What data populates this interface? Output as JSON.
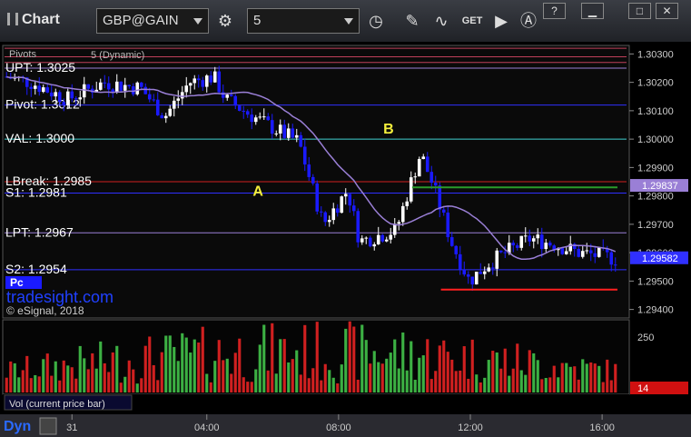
{
  "app": {
    "title": "Chart"
  },
  "toolbar": {
    "symbol": "GBP@GAIN",
    "interval": "5",
    "get_label": "GET"
  },
  "overlay": {
    "study_label": "Pivots",
    "ma_label": "5 (Dynamic)",
    "watermark": "tradesight.com",
    "copyright": "© eSignal, 2018",
    "pc_badge": "Pc",
    "vol_label": "Vol (current price bar)",
    "dyn_label": "Dyn"
  },
  "colors": {
    "up": "#ffffff",
    "down": "#1a1aff",
    "ma": "#9a7fd6",
    "vol_up": "#3cb043",
    "vol_down": "#d02020"
  },
  "chart_data": {
    "type": "candlestick",
    "ylim": [
      1.2937,
      1.3033
    ],
    "y_ticks": [
      "1.30300",
      "1.30200",
      "1.30100",
      "1.30000",
      "1.29900",
      "1.29800",
      "1.29700",
      "1.29600",
      "1.29500",
      "1.29400"
    ],
    "x_ticks": [
      "31",
      "04:00",
      "08:00",
      "12:00",
      "16:00"
    ],
    "levels": [
      {
        "label": "UPT: 1.3025",
        "value": 1.3025,
        "color": "#9a7fd6"
      },
      {
        "label": "Pivot: 1.3012",
        "value": 1.3012,
        "color": "#3030ff"
      },
      {
        "label": "VAL: 1.3000",
        "value": 1.3,
        "color": "#40d0d0"
      },
      {
        "label": "LBreak: 1.2985",
        "value": 1.2985,
        "color": "#d02020"
      },
      {
        "label": "S1: 1.2981",
        "value": 1.2981,
        "color": "#3030ff"
      },
      {
        "label": "LPT: 1.2967",
        "value": 1.2967,
        "color": "#9a7fd6"
      },
      {
        "label": "S2: 1.2954",
        "value": 1.2954,
        "color": "#3030ff"
      }
    ],
    "top_lines": [
      1.3032,
      1.3029,
      1.3027
    ],
    "price_badges": [
      {
        "label": "1.29837",
        "value": 1.29837,
        "color": "#9a7fd6"
      },
      {
        "label": "1.29582",
        "value": 1.29582,
        "color": "#3030ff"
      }
    ],
    "annotations": [
      {
        "text": "A",
        "x": 0.405,
        "value": 1.298
      },
      {
        "text": "B",
        "x": 0.618,
        "value": 1.3002
      }
    ],
    "marker_lines": [
      {
        "value": 1.2983,
        "x0": 0.665,
        "x1": 1.0,
        "color": "#2a9a2a"
      },
      {
        "value": 1.2947,
        "x0": 0.712,
        "x1": 1.0,
        "color": "#ff2020"
      }
    ],
    "anchors": [
      [
        0,
        1.3022
      ],
      [
        0.04,
        1.302
      ],
      [
        0.1,
        1.3014
      ],
      [
        0.16,
        1.302
      ],
      [
        0.22,
        1.3018
      ],
      [
        0.26,
        1.3008
      ],
      [
        0.3,
        1.302
      ],
      [
        0.34,
        1.3022
      ],
      [
        0.36,
        1.3014
      ],
      [
        0.42,
        1.3006
      ],
      [
        0.48,
        1.2999
      ],
      [
        0.52,
        1.297
      ],
      [
        0.56,
        1.2982
      ],
      [
        0.58,
        1.2964
      ],
      [
        0.64,
        1.2968
      ],
      [
        0.66,
        1.2982
      ],
      [
        0.68,
        1.2995
      ],
      [
        0.7,
        1.2984
      ],
      [
        0.73,
        1.2964
      ],
      [
        0.76,
        1.295
      ],
      [
        0.79,
        1.2956
      ],
      [
        0.82,
        1.296
      ],
      [
        0.86,
        1.2965
      ],
      [
        0.9,
        1.2963
      ],
      [
        0.94,
        1.296
      ],
      [
        1.0,
        1.2958
      ]
    ],
    "volume_ticks": [
      "250"
    ],
    "volume_value": "14",
    "volume_ylim": [
      0,
      320
    ]
  }
}
